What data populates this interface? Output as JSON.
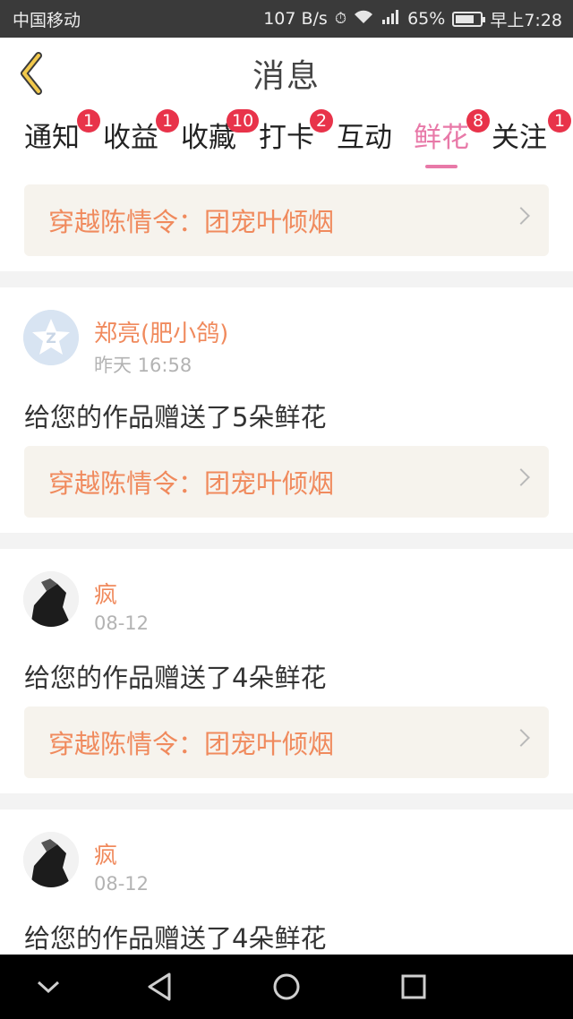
{
  "status_bar": {
    "carrier": "中国移动",
    "speed": "107 B/s",
    "battery_pct": "65%",
    "time": "早上7:28"
  },
  "header": {
    "title": "消息"
  },
  "tabs": [
    {
      "label": "通知",
      "badge": "1"
    },
    {
      "label": "收益",
      "badge": "1"
    },
    {
      "label": "收藏",
      "badge": "10"
    },
    {
      "label": "打卡",
      "badge": "2"
    },
    {
      "label": "互动",
      "badge": ""
    },
    {
      "label": "鲜花",
      "badge": "8",
      "active": true
    },
    {
      "label": "关注",
      "badge": "1"
    }
  ],
  "colors": {
    "accent": "#e879a8",
    "badge": "#e8334a",
    "link_text": "#f08a5d",
    "link_bg": "#f6f3ed"
  },
  "top_link": "穿越陈情令：团宠叶倾烟",
  "messages": [
    {
      "user": "郑亮(肥小鸽)",
      "time": "昨天 16:58",
      "text": "给您的作品赠送了5朵鲜花",
      "work": "穿越陈情令：团宠叶倾烟",
      "avatar": "default-avatar-icon"
    },
    {
      "user": "疯",
      "time": "08-12",
      "text": "给您的作品赠送了4朵鲜花",
      "work": "穿越陈情令：团宠叶倾烟",
      "avatar": "user-photo"
    },
    {
      "user": "疯",
      "time": "08-12",
      "text": "给您的作品赠送了4朵鲜花",
      "avatar": "user-photo"
    }
  ]
}
